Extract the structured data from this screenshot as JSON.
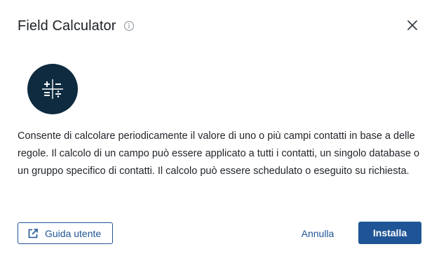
{
  "dialog": {
    "title": "Field Calculator",
    "info_icon": "info-circle-icon",
    "close_icon": "close-icon"
  },
  "app": {
    "icon": "calculator-icon",
    "icon_bg": "#0e2b3f"
  },
  "description": "Consente di calcolare periodicamente il valore di uno o più campi contatti in base a delle regole. Il calcolo di un campo può essere applicato a tutti i contatti, un singolo database o un gruppo specifico di contatti. Il calcolo può essere schedulato o eseguito su richiesta.",
  "footer": {
    "guide_label": "Guida utente",
    "guide_icon": "external-link-icon",
    "cancel_label": "Annulla",
    "install_label": "Installa"
  },
  "colors": {
    "accent": "#1f5596",
    "text": "#1f2329"
  }
}
